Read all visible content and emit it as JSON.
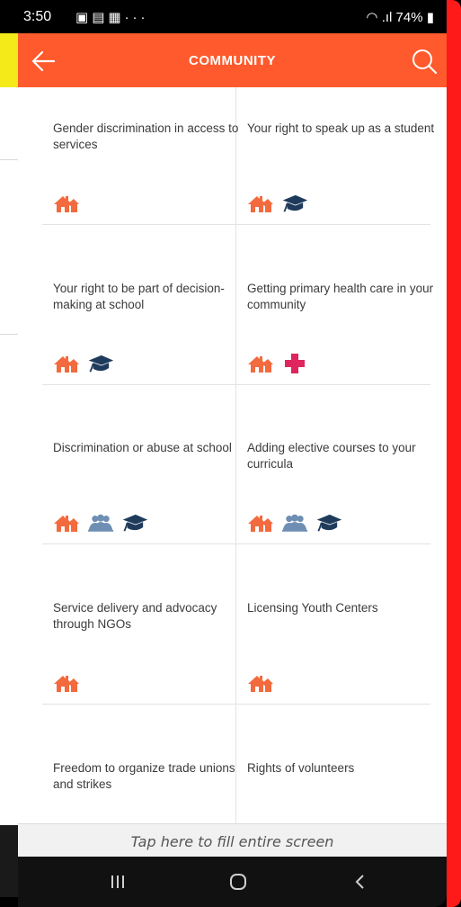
{
  "status_bar": {
    "time": "3:50",
    "icons": [
      "image-icon",
      "vibrate-icon",
      "gift-icon",
      "more-icon"
    ],
    "overflow": "···",
    "battery": "74%",
    "right_icons": [
      "wifi-icon",
      "signal-icon",
      "battery-icon"
    ]
  },
  "app_bar": {
    "title": "COMMUNITY",
    "back_icon": "arrow-left-icon",
    "search_icon": "search-icon",
    "color": "#fe5a2d"
  },
  "cards": [
    {
      "title": "Gender discrimination in access to services",
      "icons": [
        "house"
      ]
    },
    {
      "title": "Your right to speak up as a student",
      "icons": [
        "house",
        "graduation-cap"
      ]
    },
    {
      "title": "Your right to be part of decision-making at school",
      "icons": [
        "house",
        "graduation-cap"
      ]
    },
    {
      "title": "Getting primary health care in your community",
      "icons": [
        "house",
        "health-cross"
      ]
    },
    {
      "title": "Discrimination or abuse at school",
      "icons": [
        "house",
        "people",
        "graduation-cap"
      ]
    },
    {
      "title": "Adding elective courses to your curricula",
      "icons": [
        "house",
        "people",
        "graduation-cap"
      ]
    },
    {
      "title": "Service delivery and advocacy through NGOs",
      "icons": [
        "house"
      ]
    },
    {
      "title": "Licensing Youth Centers",
      "icons": [
        "house"
      ]
    },
    {
      "title": "Freedom to organize trade unions and strikes",
      "icons": []
    },
    {
      "title": "Rights of volunteers",
      "icons": []
    }
  ],
  "fill_screen": {
    "label": "Tap here to fill entire screen"
  },
  "nav_bar": {
    "recents_icon": "recents-icon",
    "home_icon": "home-icon",
    "back_icon": "back-chevron-icon"
  },
  "colors": {
    "accent": "#fe5a2d",
    "house": "#f26a3d",
    "cap": "#1f3b5c",
    "people": "#6e8fb3",
    "cross": "#e0245e",
    "frame_red": "#ff1a1a",
    "frame_yellow": "#f4ea1a"
  }
}
